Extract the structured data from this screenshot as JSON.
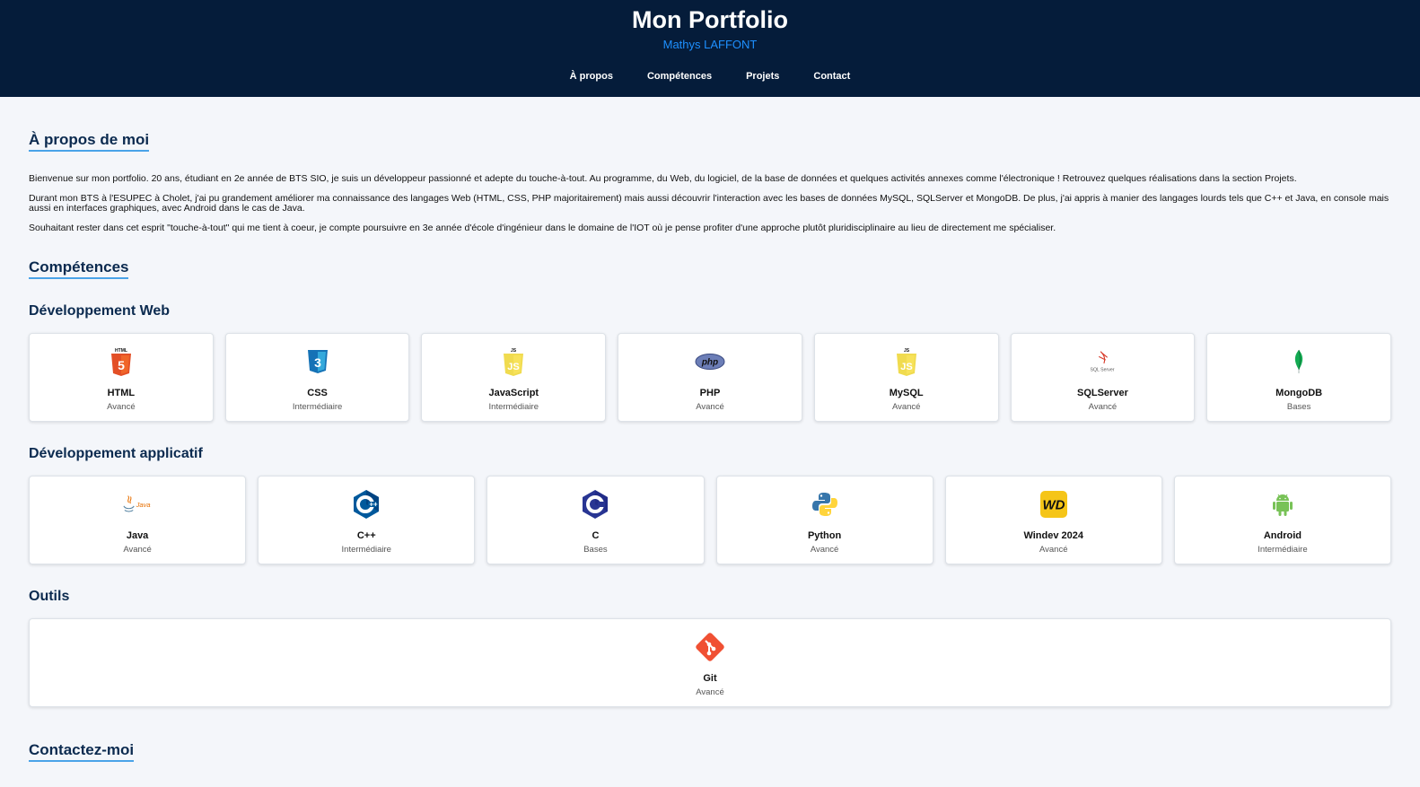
{
  "header": {
    "title": "Mon Portfolio",
    "subtitle": "Mathys LAFFONT",
    "nav": [
      "À propos",
      "Compétences",
      "Projets",
      "Contact"
    ]
  },
  "about": {
    "heading": "À propos de moi",
    "paragraphs": [
      "Bienvenue sur mon portfolio. 20 ans, étudiant en 2e année de BTS SIO, je suis un développeur passionné et adepte du touche-à-tout. Au programme, du Web, du logiciel, de la base de données et quelques activités annexes comme l'électronique ! Retrouvez quelques réalisations dans la section Projets.",
      "Durant mon BTS à l'ESUPEC à Cholet, j'ai pu grandement améliorer ma connaissance des langages Web (HTML, CSS, PHP majoritairement) mais aussi découvrir l'interaction avec les bases de données MySQL, SQLServer et MongoDB. De plus, j'ai appris à manier des langages lourds tels que C++ et Java, en console mais aussi en interfaces graphiques, avec Android dans le cas de Java.",
      "Souhaitant rester dans cet esprit \"touche-à-tout\" qui me tient à coeur, je compte poursuivre en 3e année d'école d'ingénieur dans le domaine de l'IOT où je pense profiter d'une approche plutôt pluridisciplinaire au lieu de directement me spécialiser."
    ]
  },
  "skills": {
    "heading": "Compétences",
    "web": {
      "title": "Développement Web",
      "items": [
        {
          "name": "HTML",
          "level": "Avancé",
          "icon": "html5-icon",
          "icon_text": "HTML"
        },
        {
          "name": "CSS",
          "level": "Intermédiaire",
          "icon": "css3-icon"
        },
        {
          "name": "JavaScript",
          "level": "Intermédiaire",
          "icon": "javascript-icon",
          "icon_text": "JS"
        },
        {
          "name": "PHP",
          "level": "Avancé",
          "icon": "php-icon",
          "icon_text": "php"
        },
        {
          "name": "MySQL",
          "level": "Avancé",
          "icon": "javascript-icon",
          "icon_text": "JS"
        },
        {
          "name": "SQLServer",
          "level": "Avancé",
          "icon": "sqlserver-icon",
          "icon_text": "SQL Server"
        },
        {
          "name": "MongoDB",
          "level": "Bases",
          "icon": "mongodb-leaf-icon"
        }
      ]
    },
    "app": {
      "title": "Développement applicatif",
      "items": [
        {
          "name": "Java",
          "level": "Avancé",
          "icon": "java-icon",
          "icon_text": "Java"
        },
        {
          "name": "C++",
          "level": "Intermédiaire",
          "icon": "cpp-icon"
        },
        {
          "name": "C",
          "level": "Bases",
          "icon": "c-icon"
        },
        {
          "name": "Python",
          "level": "Avancé",
          "icon": "python-icon"
        },
        {
          "name": "Windev 2024",
          "level": "Avancé",
          "icon": "windev-icon",
          "icon_text": "WD"
        },
        {
          "name": "Android",
          "level": "Intermédiaire",
          "icon": "android-icon"
        }
      ]
    },
    "tools": {
      "title": "Outils",
      "items": [
        {
          "name": "Git",
          "level": "Avancé",
          "icon": "git-icon"
        }
      ]
    }
  },
  "contact": {
    "heading": "Contactez-moi"
  },
  "colors": {
    "header_bg": "#051c3a",
    "accent": "#1e90ff",
    "heading": "#0b2a4f"
  }
}
